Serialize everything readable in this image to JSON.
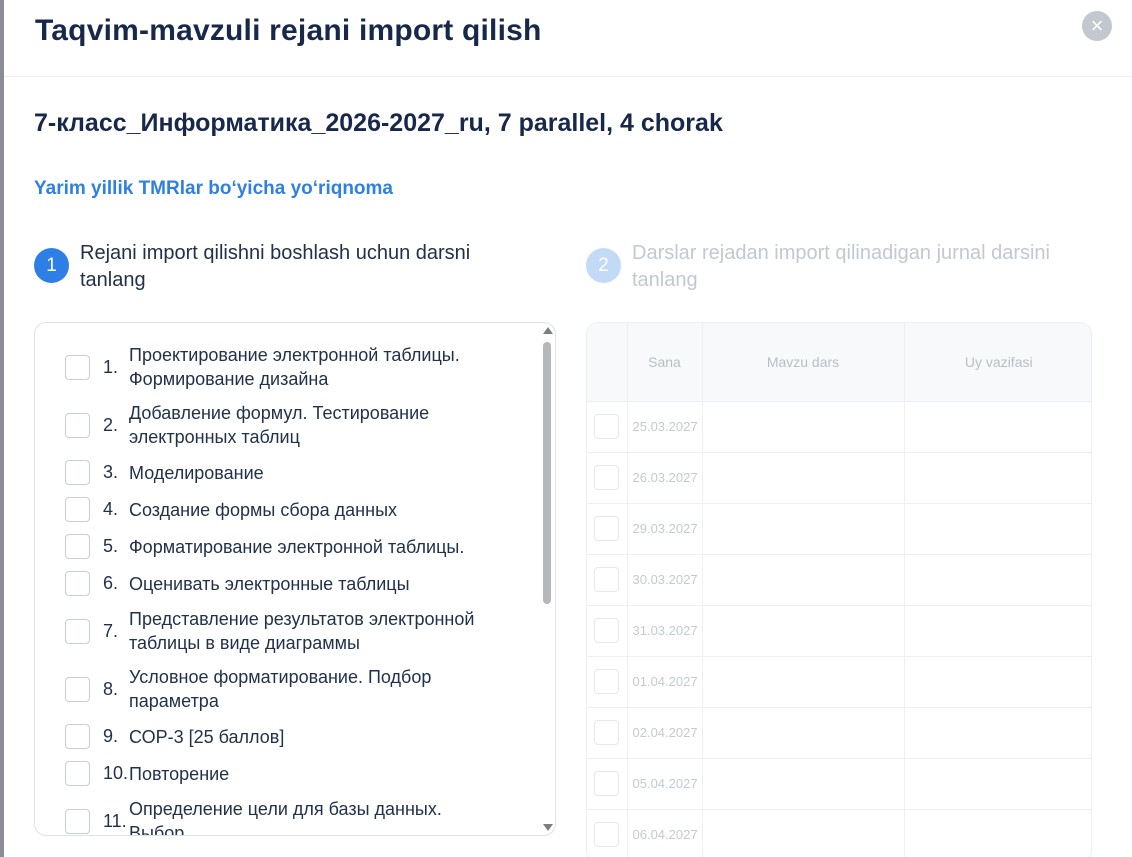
{
  "modal": {
    "title": "Taqvim-mavzuli rejani import qilish",
    "close_glyph": "×"
  },
  "subtitle": "7-класс_Информатика_2026-2027_ru, 7 parallel, 4 chorak",
  "guide_link": "Yarim yillik TMRlar bo‘yicha yo‘riqnoma",
  "steps": [
    {
      "number": "1",
      "text": "Rejani import qilishni boshlash uchun darsni tanlang",
      "active": true
    },
    {
      "number": "2",
      "text": "Darslar rejadan import qilinadigan jurnal darsini tanlang",
      "active": false
    }
  ],
  "lessons": [
    {
      "num": "1.",
      "text": "Проектирование электронной таблицы. Формирование дизайна"
    },
    {
      "num": "2.",
      "text": "Добавление формул. Тестирование электронных таблиц"
    },
    {
      "num": "3.",
      "text": "Моделирование"
    },
    {
      "num": "4.",
      "text": "Создание формы сбора данных"
    },
    {
      "num": "5.",
      "text": "Форматирование электронной таблицы."
    },
    {
      "num": "6.",
      "text": "Оценивать электронные таблицы"
    },
    {
      "num": "7.",
      "text": "Представление результатов электронной таблицы в виде диаграммы"
    },
    {
      "num": "8.",
      "text": "Условное форматирование. Подбор параметра"
    },
    {
      "num": "9.",
      "text": "СОР-3 [25 баллов]"
    },
    {
      "num": "10.",
      "text": "Повторение"
    },
    {
      "num": "11.",
      "text": "Определение цели для базы данных. Выбор"
    }
  ],
  "journal": {
    "headers": {
      "date": "Sana",
      "topic": "Mavzu dars",
      "homework": "Uy vazifasi"
    },
    "rows": [
      {
        "date": "25.03.2027"
      },
      {
        "date": "26.03.2027"
      },
      {
        "date": "29.03.2027"
      },
      {
        "date": "30.03.2027"
      },
      {
        "date": "31.03.2027"
      },
      {
        "date": "01.04.2027"
      },
      {
        "date": "02.04.2027"
      },
      {
        "date": "05.04.2027"
      },
      {
        "date": "06.04.2027"
      }
    ]
  },
  "colors": {
    "title": "#17284a",
    "link": "#2f80e0",
    "step_active": "#2d7fe6",
    "step_inactive": "#c3daf7"
  },
  "icons": {
    "close": "close-icon",
    "scroll_up": "scroll-up-arrow-icon",
    "scroll_down": "scroll-down-arrow-icon"
  }
}
